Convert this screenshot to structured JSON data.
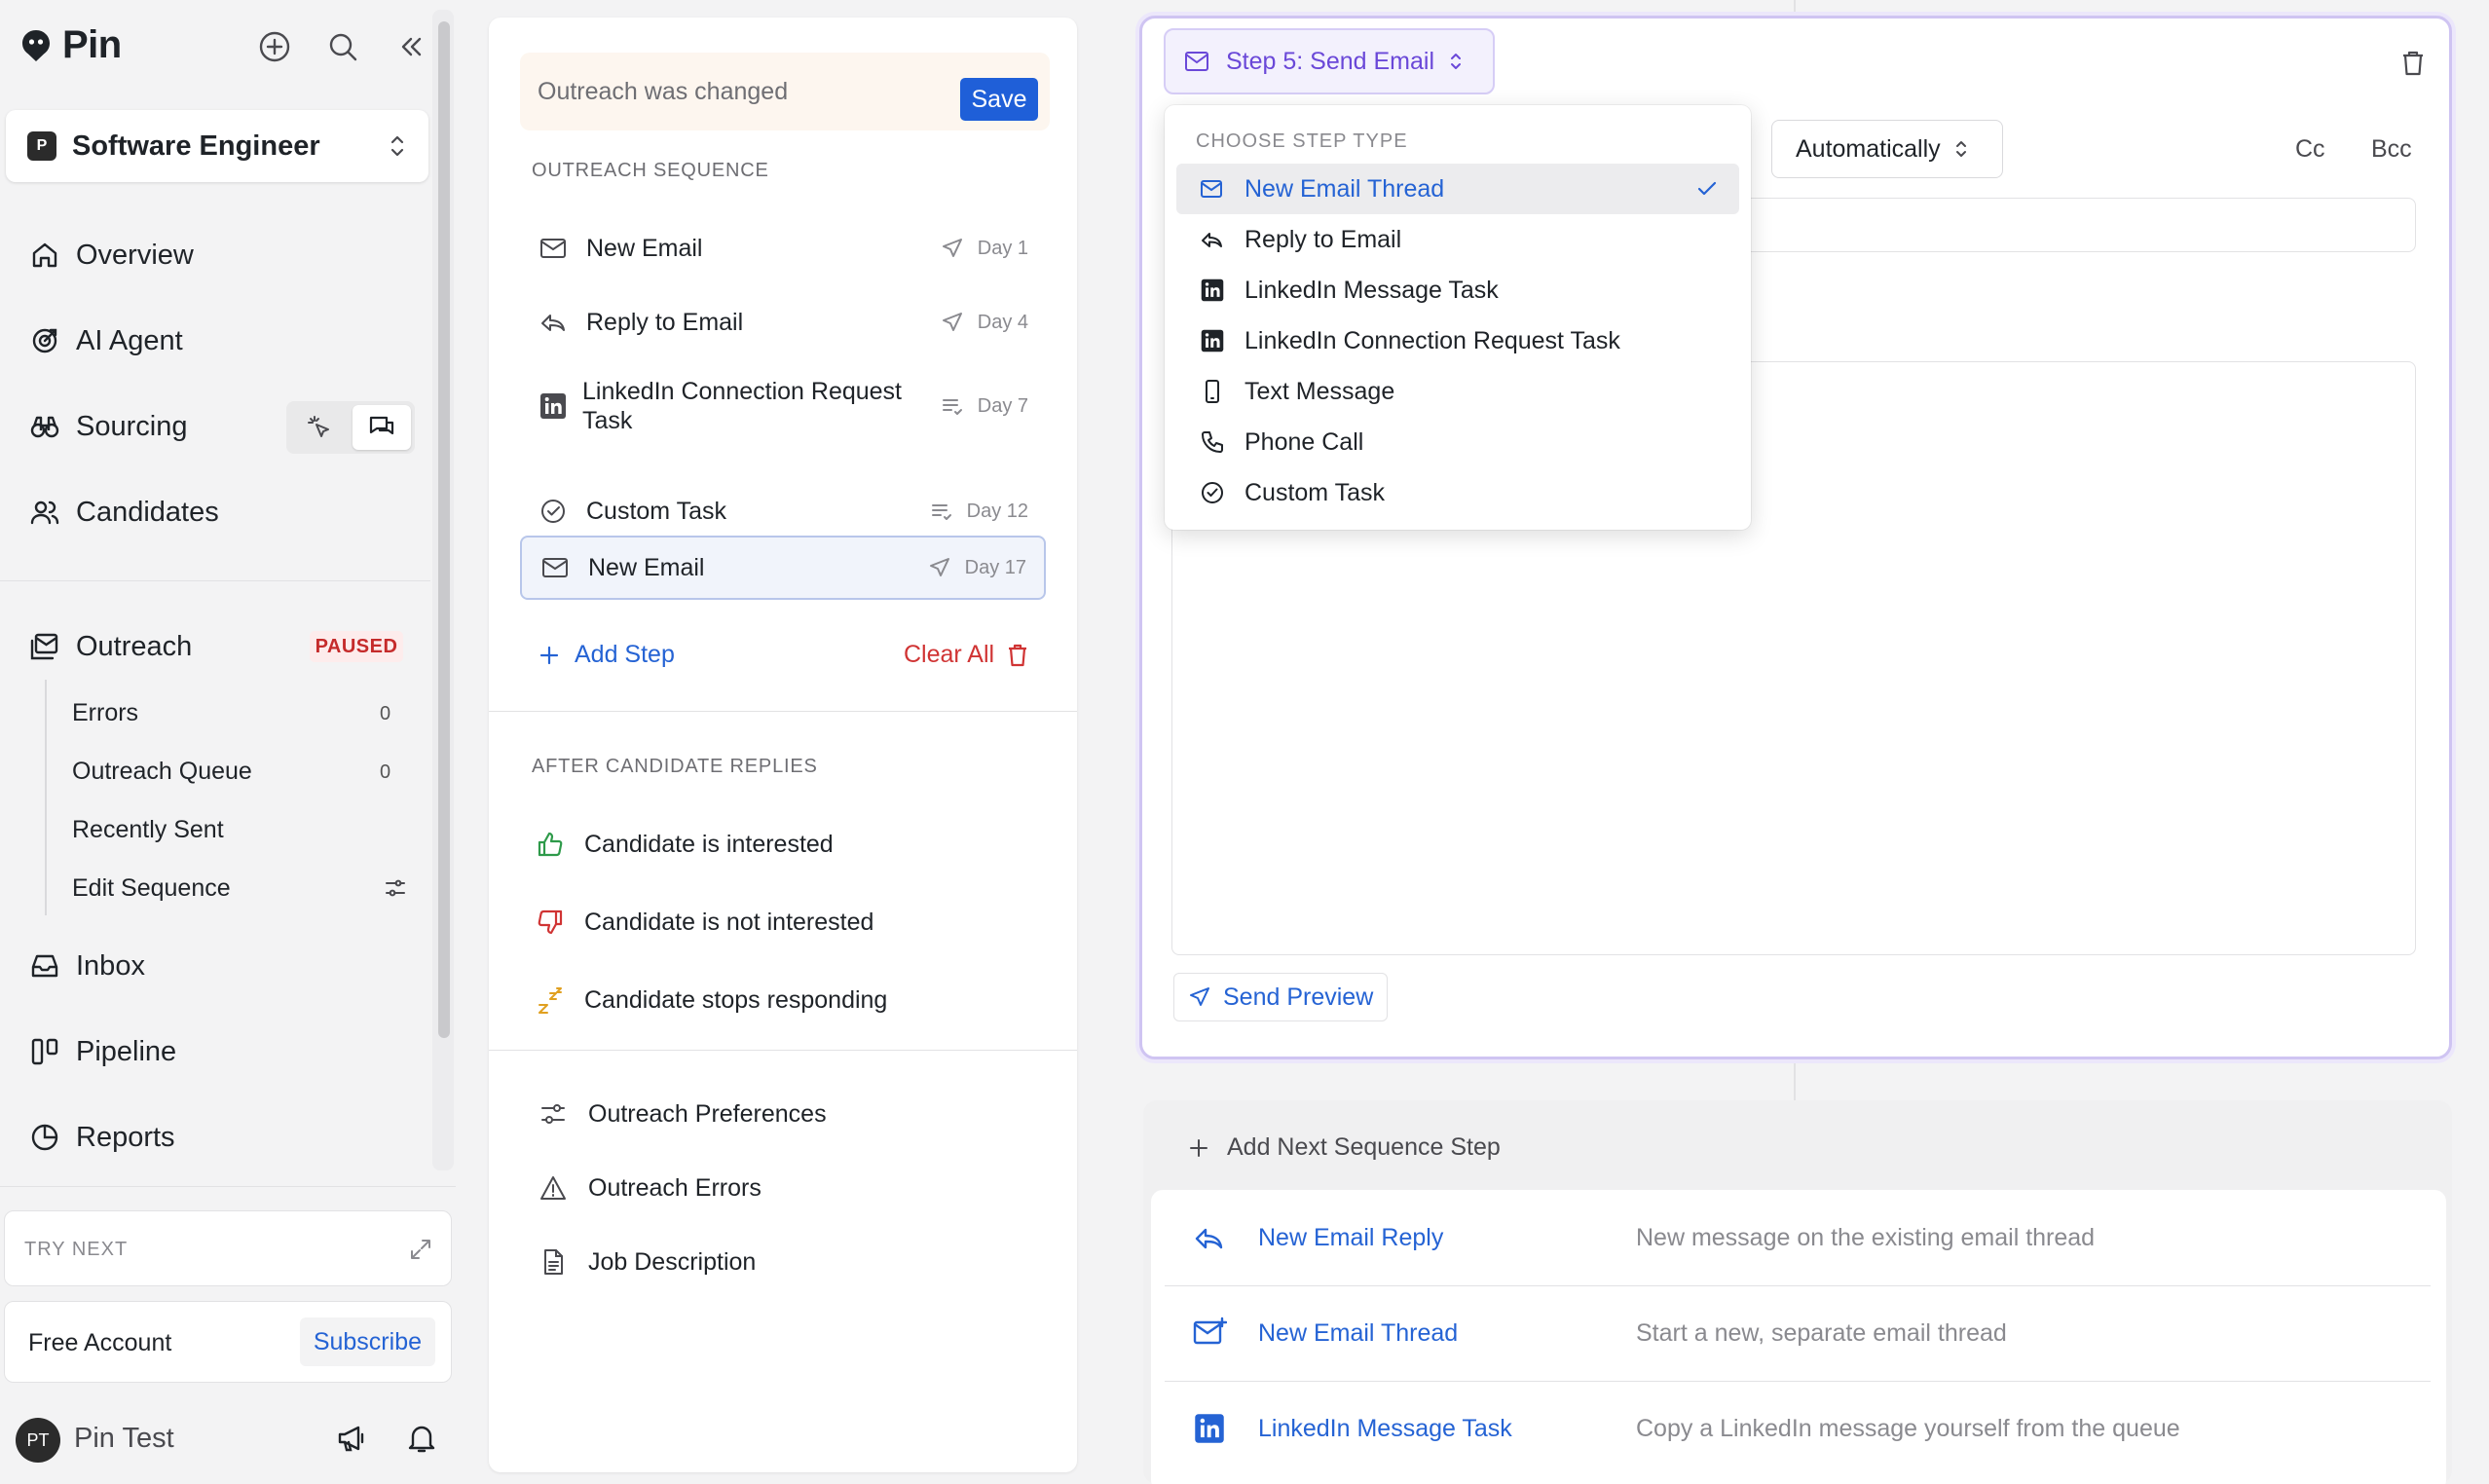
{
  "app": {
    "name": "Pin"
  },
  "sidebar": {
    "job": {
      "badge": "P",
      "label": "Software Engineer"
    },
    "nav": [
      {
        "label": "Overview",
        "icon": "home-icon"
      },
      {
        "label": "AI Agent",
        "icon": "target-icon"
      },
      {
        "label": "Sourcing",
        "icon": "binoculars-icon"
      },
      {
        "label": "Candidates",
        "icon": "users-icon"
      }
    ],
    "outreach": {
      "label": "Outreach",
      "status": "PAUSED",
      "items": [
        {
          "label": "Errors",
          "count": "0"
        },
        {
          "label": "Outreach Queue",
          "count": "0"
        },
        {
          "label": "Recently Sent"
        },
        {
          "label": "Edit Sequence"
        }
      ]
    },
    "nav2": [
      {
        "label": "Inbox",
        "icon": "inbox-icon"
      },
      {
        "label": "Pipeline",
        "icon": "kanban-icon"
      },
      {
        "label": "Reports",
        "icon": "pie-chart-icon"
      }
    ],
    "try_next": "TRY NEXT",
    "account": {
      "label": "Free Account",
      "action": "Subscribe"
    },
    "user": {
      "initials": "PT",
      "name": "Pin Test"
    }
  },
  "sequence": {
    "changed_text": "Outreach was changed",
    "save_label": "Save",
    "section_title": "OUTREACH SEQUENCE",
    "steps": [
      {
        "label": "New Email",
        "day": "Day 1"
      },
      {
        "label": "Reply to Email",
        "day": "Day 4"
      },
      {
        "label": "LinkedIn Connection Request Task",
        "day": "Day 7"
      },
      {
        "label": "Custom Task",
        "day": "Day 12"
      },
      {
        "label": "New Email",
        "day": "Day 17"
      }
    ],
    "add_step": "Add Step",
    "clear_all": "Clear All",
    "after_title": "AFTER CANDIDATE REPLIES",
    "after": [
      {
        "label": "Candidate is interested"
      },
      {
        "label": "Candidate is not interested"
      },
      {
        "label": "Candidate stops responding"
      }
    ],
    "footer": [
      {
        "label": "Outreach Preferences"
      },
      {
        "label": "Outreach Errors"
      },
      {
        "label": "Job Description"
      }
    ]
  },
  "editor": {
    "step_label": "Step 5: Send Email",
    "send_mode": "Automatically",
    "cc": "Cc",
    "bcc": "Bcc",
    "send_preview": "Send Preview"
  },
  "step_menu": {
    "heading": "CHOOSE STEP TYPE",
    "items": [
      {
        "label": "New Email Thread",
        "selected": true
      },
      {
        "label": "Reply to Email"
      },
      {
        "label": "LinkedIn Message Task"
      },
      {
        "label": "LinkedIn Connection Request Task"
      },
      {
        "label": "Text Message"
      },
      {
        "label": "Phone Call"
      },
      {
        "label": "Custom Task"
      }
    ]
  },
  "next_step": {
    "label": "Add Next Sequence Step",
    "options": [
      {
        "name": "New Email Reply",
        "desc": "New message on the existing email thread"
      },
      {
        "name": "New Email Thread",
        "desc": "Start a new, separate email thread"
      },
      {
        "name": "LinkedIn Message Task",
        "desc": "Copy a LinkedIn message yourself from the queue"
      }
    ]
  },
  "colors": {
    "accent_blue": "#2563d4",
    "save_blue": "#1f5fd8",
    "step_purple": "#6a48d8",
    "danger_red": "#d03434",
    "interested_green": "#2e9a4a"
  }
}
